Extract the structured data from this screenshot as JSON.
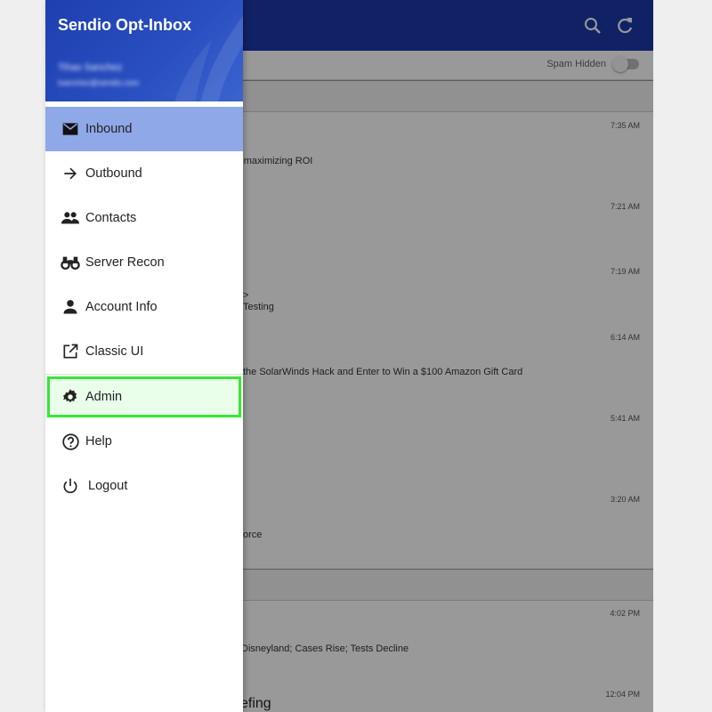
{
  "app": {
    "title": "Sendio Opt-Inbox",
    "user_name": "Tihas Sanchez",
    "user_email": "tsanchez@sendio.com",
    "spam_toggle_label": "Spam Hidden",
    "colors": {
      "brand": "#1b3aa8",
      "active_item": "#8fa8e8",
      "highlight": "#3de33d"
    }
  },
  "menu": {
    "items": [
      {
        "label": "Inbound",
        "icon": "mail-icon"
      },
      {
        "label": "Outbound",
        "icon": "arrow-right-icon"
      },
      {
        "label": "Contacts",
        "icon": "people-icon"
      },
      {
        "label": "Server Recon",
        "icon": "binoculars-icon"
      },
      {
        "label": "Account Info",
        "icon": "person-icon"
      },
      {
        "label": "Classic UI",
        "icon": "open-in-new-icon"
      },
      {
        "label": "Admin",
        "icon": "gear-icon"
      },
      {
        "label": "Help",
        "icon": "help-circle-icon"
      },
      {
        "label": "Logout",
        "icon": "power-icon"
      }
    ]
  },
  "messages": [
    {
      "time": "7:35 AM",
      "text": "r maximizing ROI"
    },
    {
      "time": "7:21 AM",
      "text": ""
    },
    {
      "time": "7:19 AM",
      "text_line1": ">",
      "text_line2": "Testing"
    },
    {
      "time": "6:14 AM",
      "text": "the SolarWinds Hack and Enter to Win a $100 Amazon Gift Card"
    },
    {
      "time": "5:41 AM",
      "text": ""
    },
    {
      "time": "3:20 AM",
      "text": "orce"
    },
    {
      "time": "4:02 PM",
      "text": "Disneyland; Cases Rise; Tests Decline"
    },
    {
      "time": "12:04 PM",
      "text": "efing"
    }
  ]
}
